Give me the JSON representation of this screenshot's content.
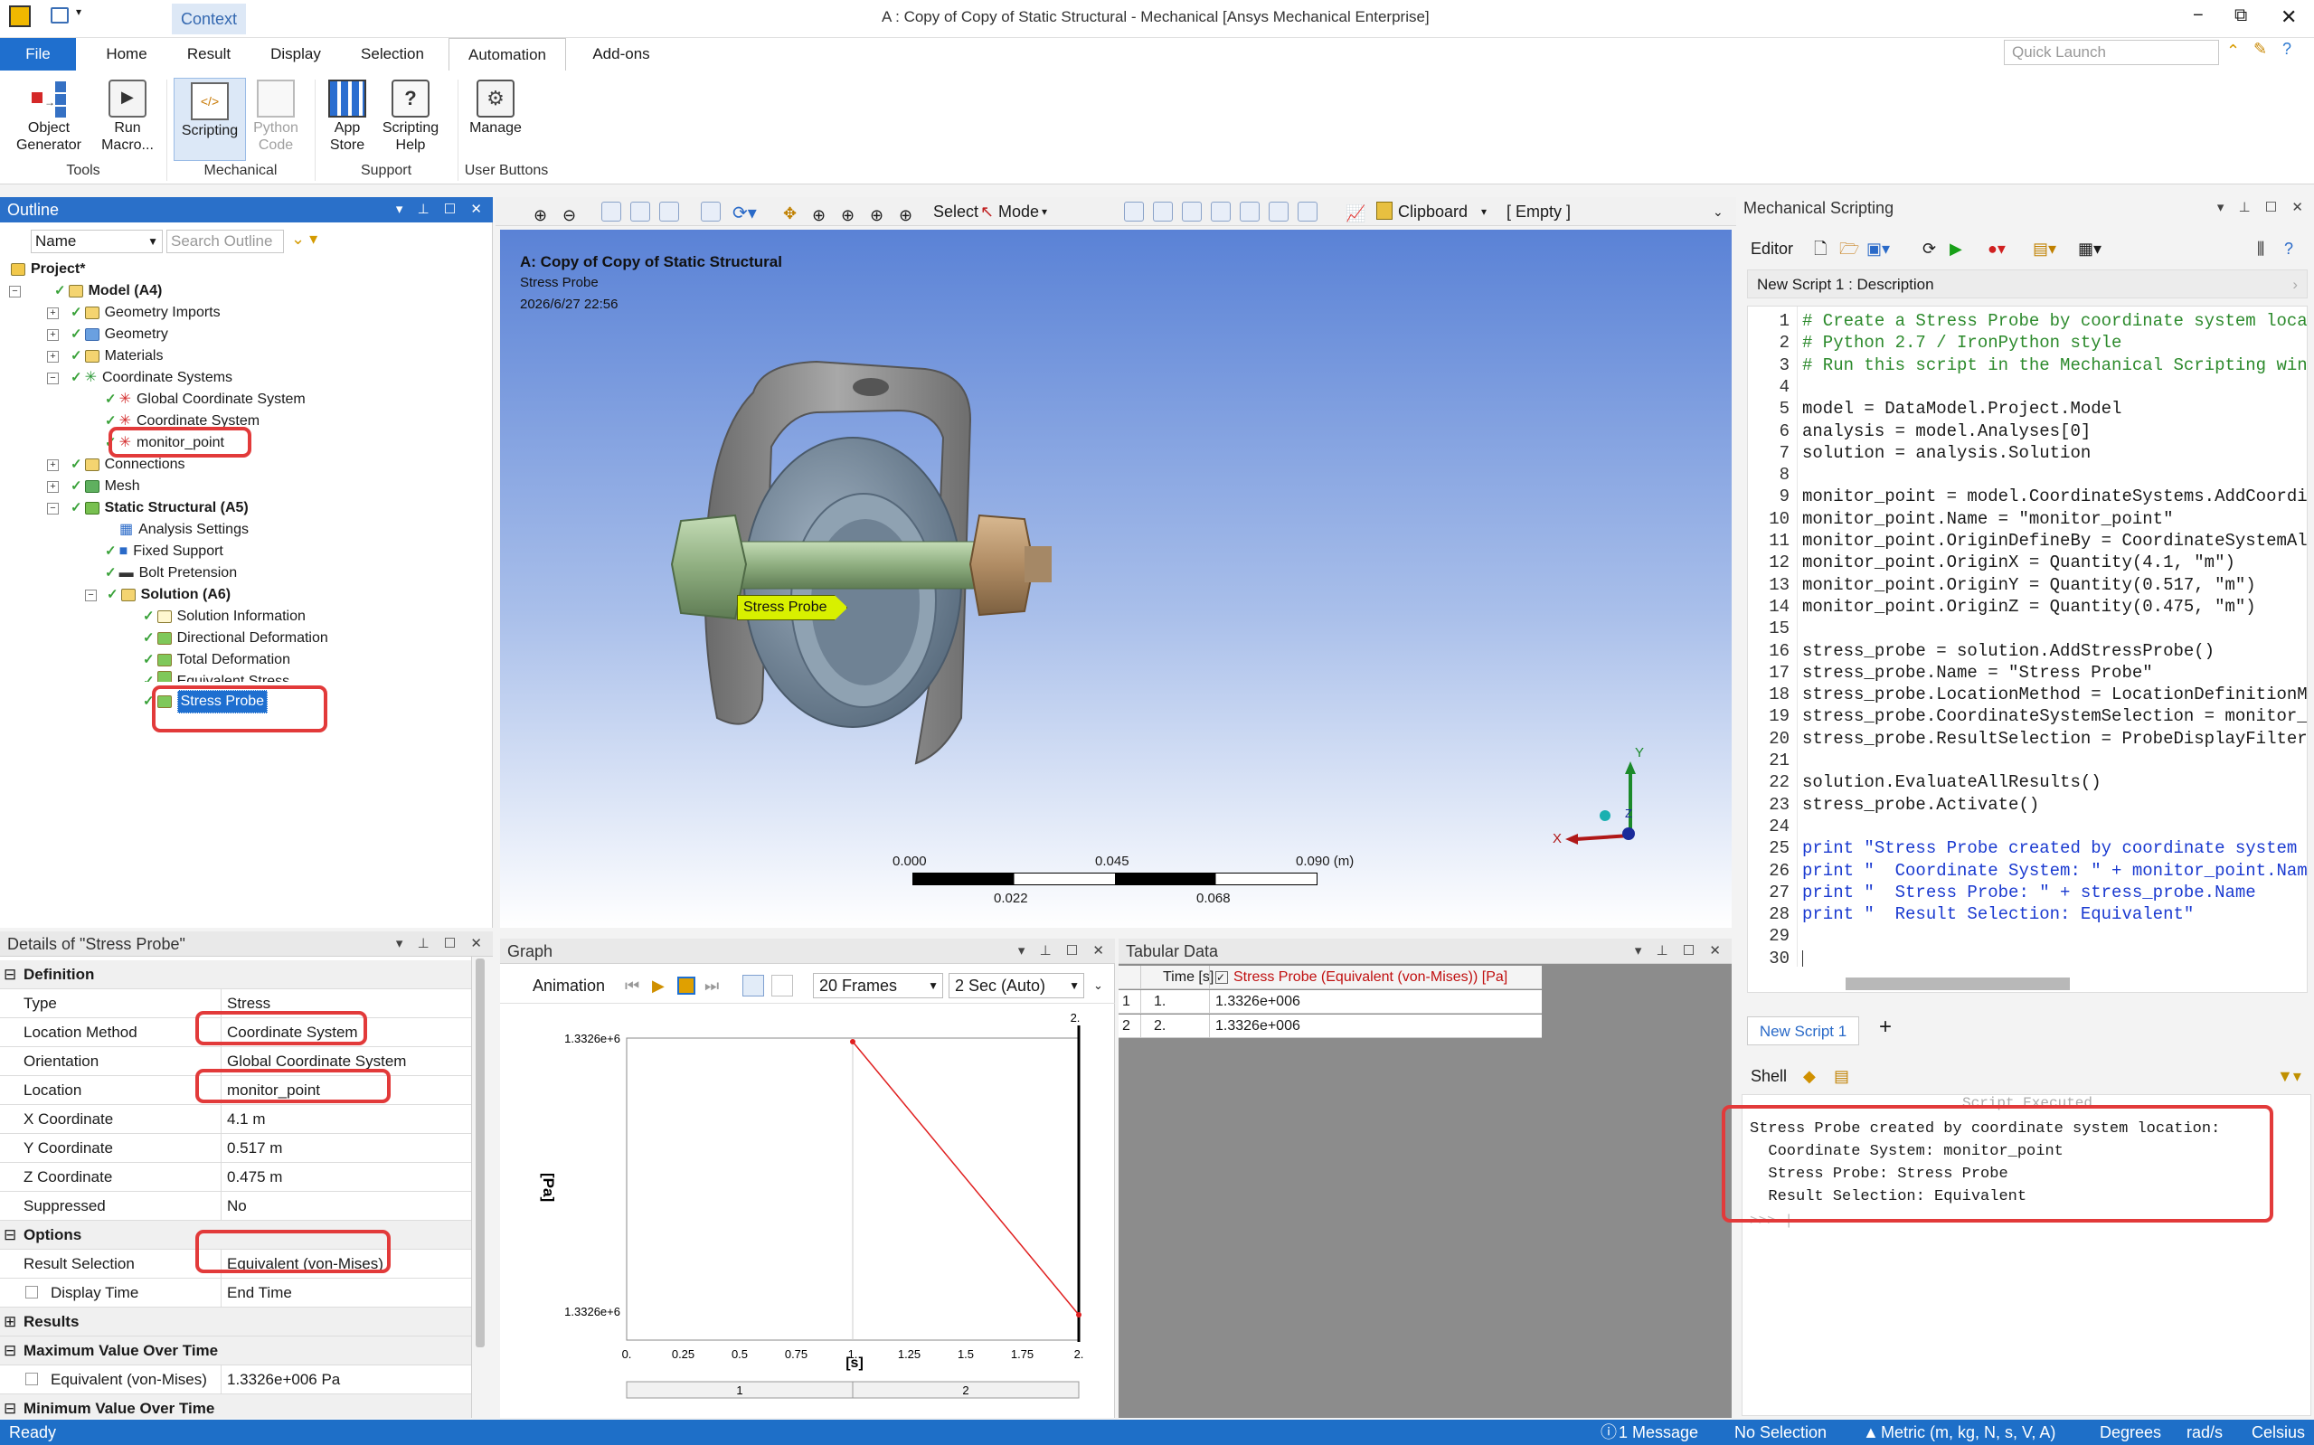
{
  "titlebar": {
    "title": "A : Copy of Copy of Static Structural - Mechanical [Ansys Mechanical Enterprise]",
    "context_tab": "Context",
    "quick_launch_placeholder": "Quick Launch",
    "min": "−",
    "restore": "⧉",
    "close": "✕"
  },
  "ribbon": {
    "tabs": [
      "File",
      "Home",
      "Result",
      "Display",
      "Selection",
      "Automation",
      "Add-ons"
    ],
    "active_tab": "Automation",
    "buttons": {
      "object_generator": "Object\nGenerator",
      "run_macro": "Run\nMacro...",
      "scripting": "Scripting",
      "python_code": "Python\nCode",
      "app_store": "App\nStore",
      "scripting_help": "Scripting\nHelp",
      "manage": "Manage"
    },
    "groups": [
      "Tools",
      "Mechanical",
      "Support",
      "User Buttons"
    ]
  },
  "outline": {
    "title": "Outline",
    "name_filter": "Name",
    "search_placeholder": "Search Outline",
    "project": "Project*",
    "model": "Model (A4)",
    "items": {
      "geometry_imports": "Geometry Imports",
      "geometry": "Geometry",
      "materials": "Materials",
      "coordinate_systems": "Coordinate Systems",
      "global_cs": "Global Coordinate System",
      "cs": "Coordinate System",
      "monitor_point": "monitor_point",
      "connections": "Connections",
      "mesh": "Mesh",
      "static_structural": "Static Structural (A5)",
      "analysis_settings": "Analysis Settings",
      "fixed_support": "Fixed Support",
      "bolt_pretension": "Bolt Pretension",
      "solution": "Solution (A6)",
      "solution_information": "Solution Information",
      "directional_deformation": "Directional Deformation",
      "total_deformation": "Total Deformation",
      "equivalent_stress": "Equivalent Stress",
      "stress_probe": "Stress Probe"
    }
  },
  "details": {
    "title": "Details of \"Stress Probe\"",
    "sections": {
      "definition": "Definition",
      "options": "Options",
      "results": "Results",
      "max": "Maximum Value Over Time",
      "min": "Minimum Value Over Time"
    },
    "rows": {
      "type": [
        "Type",
        "Stress"
      ],
      "location_method": [
        "Location Method",
        "Coordinate System"
      ],
      "orientation": [
        "Orientation",
        "Global Coordinate System"
      ],
      "location": [
        "Location",
        "monitor_point"
      ],
      "x": [
        "X Coordinate",
        "4.1 m"
      ],
      "y": [
        "Y Coordinate",
        "0.517 m"
      ],
      "z": [
        "Z Coordinate",
        "0.475 m"
      ],
      "suppressed": [
        "Suppressed",
        "No"
      ],
      "result_selection": [
        "Result Selection",
        "Equivalent (von-Mises)"
      ],
      "display_time": [
        "Display Time",
        "End Time"
      ],
      "eq_max": [
        "Equivalent (von-Mises)",
        "1.3326e+006 Pa"
      ]
    }
  },
  "toolbar": {
    "select": "Select",
    "mode": "Mode",
    "clipboard": "Clipboard",
    "empty": "[ Empty ]"
  },
  "viewport": {
    "title": "A: Copy of Copy of Static Structural",
    "subtitle": "Stress Probe",
    "timestamp": "2026/6/27 22:56",
    "probe_label": "Stress Probe",
    "scale": {
      "t0": "0.000",
      "t1": "0.045",
      "t2": "0.090 (m)",
      "b1": "0.022",
      "b2": "0.068"
    },
    "axis": {
      "x": "X",
      "y": "Y",
      "z": "Z"
    },
    "colors": {
      "bg_top": "#5a82d6",
      "bg_bottom": "#ffffff",
      "bolt": "#8faf82",
      "nut": "#b89870",
      "bracket": "#8e8e8e",
      "ring": "#7890a4",
      "probe": "#d8f000"
    }
  },
  "graph": {
    "title": "Graph",
    "animation": "Animation",
    "frames": "20 Frames",
    "speed": "2 Sec (Auto)",
    "ylabel": "[Pa]",
    "xlabel": "[s]",
    "ytop": "1.3326e+6",
    "ybottom": "1.3326e+6",
    "xticks": [
      "0.",
      "0.25",
      "0.5",
      "0.75",
      "1.",
      "1.25",
      "1.5",
      "1.75",
      "2."
    ],
    "top_marker": "2.",
    "steps": [
      "1",
      "2"
    ]
  },
  "chart_data": {
    "type": "line",
    "x": [
      1,
      2
    ],
    "series": [
      {
        "name": "Stress Probe (Equivalent (von-Mises)) [Pa]",
        "values": [
          1332600,
          1332600
        ]
      }
    ],
    "xlabel": "[s]",
    "ylabel": "[Pa]",
    "xlim": [
      0,
      2
    ],
    "color": "#e02020"
  },
  "tabular": {
    "title": "Tabular Data",
    "headers": [
      "Time [s]",
      "Stress Probe (Equivalent (von-Mises)) [Pa]"
    ],
    "rows": [
      [
        "1",
        "1.",
        "1.3326e+006"
      ],
      [
        "2",
        "2.",
        "1.3326e+006"
      ]
    ]
  },
  "scripting": {
    "title": "Mechanical Scripting",
    "editor": "Editor",
    "description": "New Script 1 : Description",
    "tab": "New Script 1",
    "add_tab": "+",
    "code": [
      "# Create a Stress Probe by coordinate system location",
      "# Python 2.7 / IronPython style",
      "# Run this script in the Mechanical Scripting window",
      "",
      "model = DataModel.Project.Model",
      "analysis = model.Analyses[0]",
      "solution = analysis.Solution",
      "",
      "monitor_point = model.CoordinateSystems.AddCoordinateSystem()",
      "monitor_point.Name = \"monitor_point\"",
      "monitor_point.OriginDefineBy = CoordinateSystemAlignmentType.Fixed",
      "monitor_point.OriginX = Quantity(4.1, \"m\")",
      "monitor_point.OriginY = Quantity(0.517, \"m\")",
      "monitor_point.OriginZ = Quantity(0.475, \"m\")",
      "",
      "stress_probe = solution.AddStressProbe()",
      "stress_probe.Name = \"Stress Probe\"",
      "stress_probe.LocationMethod = LocationDefinitionMethod.CoordinateSystem",
      "stress_probe.CoordinateSystemSelection = monitor_point",
      "stress_probe.ResultSelection = ProbeDisplayFilter.Equivalent",
      "",
      "solution.EvaluateAllResults()",
      "stress_probe.Activate()",
      "",
      "print \"Stress Probe created by coordinate system location:\"",
      "print \"  Coordinate System: \" + monitor_point.Name",
      "print \"  Stress Probe: \" + stress_probe.Name",
      "print \"  Result Selection: Equivalent\"",
      "",
      ""
    ],
    "shell": "Shell",
    "shell_header": "Script Executed",
    "shell_lines": [
      "Stress Probe created by coordinate system location:",
      "  Coordinate System: monitor_point",
      "  Stress Probe: Stress Probe",
      "  Result Selection: Equivalent"
    ],
    "prompt": ">>> |"
  },
  "status": {
    "ready": "Ready",
    "messages": "1 Message",
    "selection": "No Selection",
    "units": "Metric (m, kg, N, s, V, A)",
    "angle": "Degrees",
    "rot": "rad/s",
    "temp": "Celsius"
  }
}
